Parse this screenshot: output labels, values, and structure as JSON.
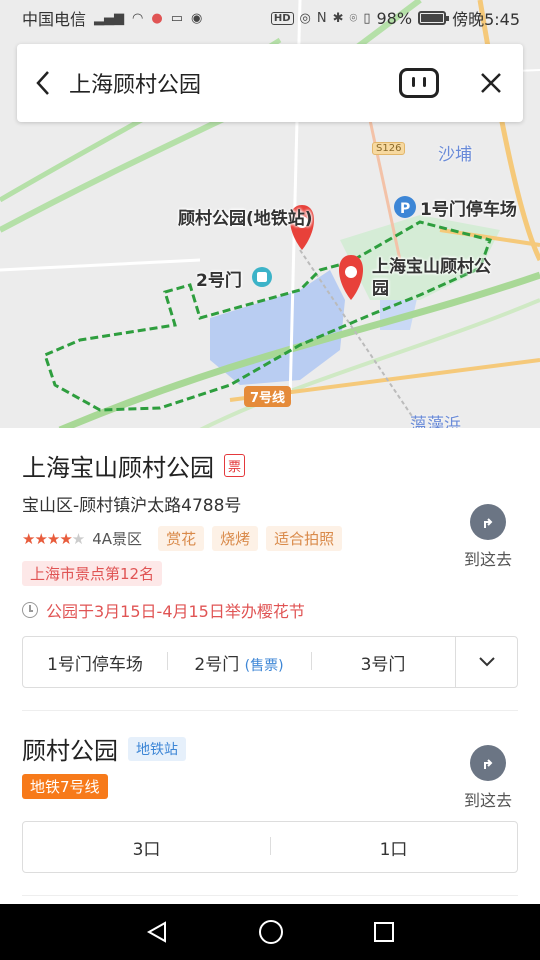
{
  "status_bar": {
    "carrier": "中国电信",
    "battery": "98%",
    "battery_level": 0.98,
    "time": "傍晚5:45"
  },
  "search": {
    "query": "上海顾村公园"
  },
  "map": {
    "labels": {
      "metro_station": "顾村公园(地铁站)",
      "gate2": "2号门",
      "park": "上海宝山顾村公园",
      "parking": "1号门停车场",
      "water_shapu": "沙埔",
      "water_south": "薀藻浜",
      "road": "S126",
      "metro_line": "7号线"
    }
  },
  "results": [
    {
      "title": "上海宝山顾村公园",
      "ticket_badge": "票",
      "address": "宝山区-顾村镇沪太路4788号",
      "rating": 4,
      "level": "4A景区",
      "tags": [
        "赏花",
        "烧烤",
        "适合拍照"
      ],
      "rank": "上海市景点第12名",
      "notice": "公园于3月15日-4月15日举办樱花节",
      "goto_label": "到这去",
      "entrances": [
        {
          "label": "1号门停车场",
          "sub": ""
        },
        {
          "label": "2号门",
          "sub": "(售票)"
        },
        {
          "label": "3号门",
          "sub": ""
        }
      ]
    },
    {
      "title": "顾村公园",
      "type_tag": "地铁站",
      "line_tag": "地铁7号线",
      "goto_label": "到这去",
      "entrances": [
        {
          "label": "3口"
        },
        {
          "label": "1口"
        }
      ]
    }
  ],
  "colors": {
    "boundary": "#2e9e3e",
    "pin": "#e8413a",
    "accent": "#3d86d6"
  }
}
